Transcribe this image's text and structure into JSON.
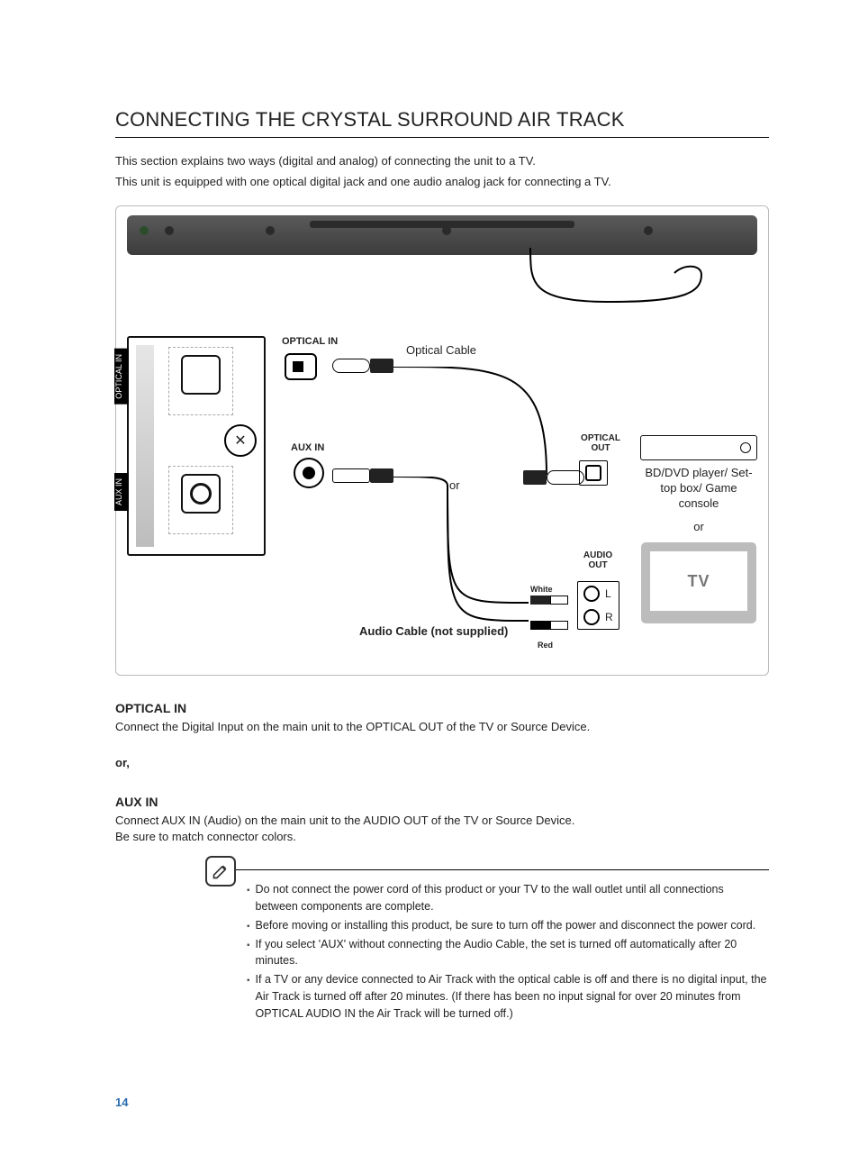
{
  "heading": "CONNECTING THE CRYSTAL SURROUND AIR TRACK",
  "intro1": "This section explains two ways (digital and analog) of connecting the unit to a TV.",
  "intro2": "This unit is equipped with one optical digital jack and one audio analog jack for connecting a TV.",
  "fig": {
    "opticalInVert": "OPTICAL IN",
    "auxInVert": "AUX IN",
    "opticalInLbl": "OPTICAL IN",
    "auxInLbl": "AUX IN",
    "opticalCable": "Optical Cable",
    "audioCable": "Audio Cable (not supplied)",
    "or": "or",
    "opticalOut": "OPTICAL OUT",
    "audioOut": "AUDIO OUT",
    "white": "White",
    "red": "Red",
    "L": "L",
    "R": "R",
    "deviceTxt": "BD/DVD player/ Set-top box/ Game console",
    "tv": "TV"
  },
  "optHead": "OPTICAL IN",
  "optBody": "Connect the Digital Input on the main unit to the OPTICAL OUT of the TV or Source Device.",
  "orTxt": "or,",
  "auxHead": "AUX IN",
  "auxBody1": "Connect AUX IN (Audio) on the main unit to the AUDIO OUT of the TV or Source Device.",
  "auxBody2": "Be sure to match connector colors.",
  "notes": [
    "Do not connect the power cord of this product or your TV to the wall outlet until all connections between components are complete.",
    "Before moving or installing this product, be sure to turn off the power and disconnect the power cord.",
    "If you select 'AUX' without connecting the Audio Cable, the set is turned off automatically after 20 minutes.",
    "If a TV or any device connected to Air Track with the optical cable is off and there is no digital input, the Air Track is turned off after 20 minutes. (If there has been no input signal for over 20 minutes from OPTICAL AUDIO IN the Air Track will be turned off.)"
  ],
  "pageNum": "14"
}
